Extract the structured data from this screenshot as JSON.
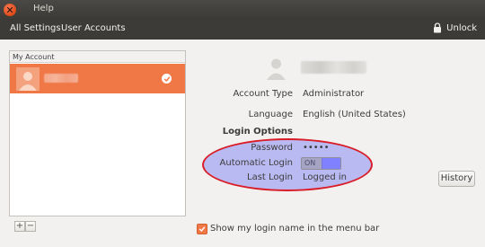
{
  "window": {
    "title": "Help"
  },
  "toolbar": {
    "breadcrumbs": [
      "All Settings",
      "User Accounts"
    ],
    "unlock_label": "Unlock"
  },
  "user_list": {
    "header": "My Account",
    "add_label": "+",
    "remove_label": "−"
  },
  "account": {
    "type_label": "Account Type",
    "type_value": "Administrator",
    "language_label": "Language",
    "language_value": "English (United States)",
    "login_options_heading": "Login Options",
    "password_label": "Password",
    "password_value": "•••••",
    "auto_login_label": "Automatic Login",
    "auto_login_state": "ON",
    "last_login_label": "Last Login",
    "last_login_value": "Logged in",
    "history_label": "History"
  },
  "footer": {
    "show_name_label": "Show my login name in the menu bar",
    "show_name_checked": true
  },
  "colors": {
    "accent": "#f07746",
    "highlight_ellipse": "#8c8cf5",
    "ellipse_border": "#d91c25"
  }
}
